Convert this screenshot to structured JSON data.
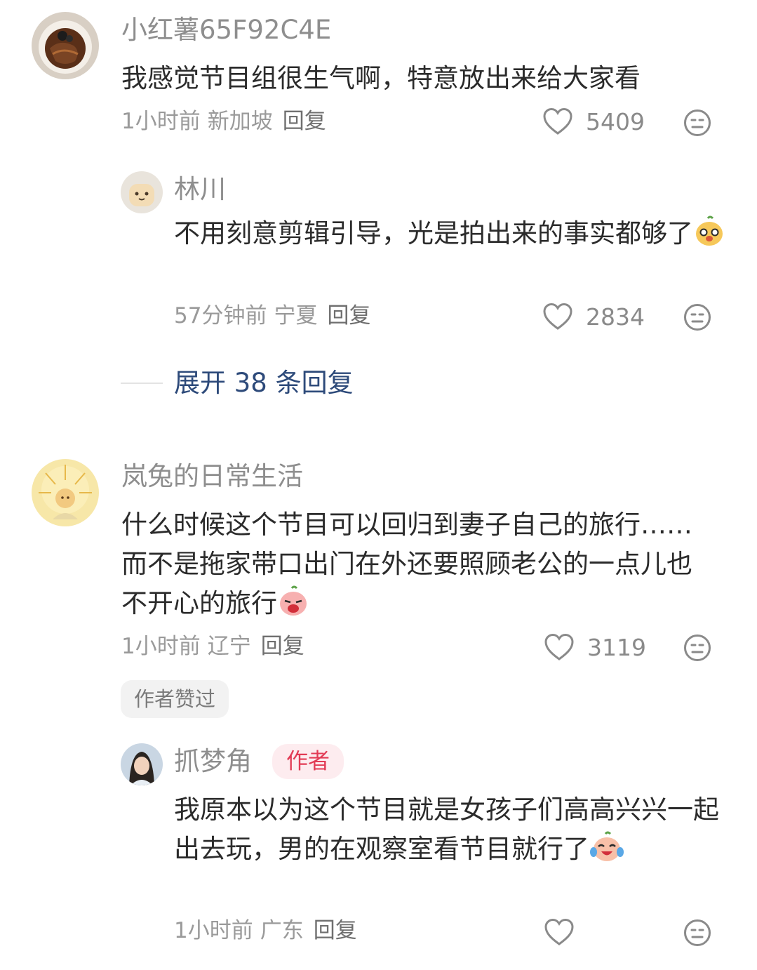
{
  "comments": [
    {
      "username": "小红薯65F92C4E",
      "text": "我感觉节目组很生气啊，特意放出来给大家看",
      "time": "1小时前",
      "region": "新加坡",
      "reply_label": "回复",
      "likes": "5409",
      "reply": {
        "username": "林川",
        "text": "不用刻意剪辑引导，光是拍出来的事实都够了",
        "time": "57分钟前",
        "region": "宁夏",
        "reply_label": "回复",
        "likes": "2834"
      },
      "expand_label": "展开 38 条回复"
    },
    {
      "username": "岚兔的日常生活",
      "text": "什么时候这个节目可以回归到妻子自己的旅行……而不是拖家带口出门在外还要照顾老公的一点儿也不开心的旅行",
      "time": "1小时前",
      "region": "辽宁",
      "reply_label": "回复",
      "likes": "3119",
      "author_liked_label": "作者赞过",
      "reply": {
        "username": "抓梦角",
        "badge": "作者",
        "text": "我原本以为这个节目就是女孩子们高高兴兴一起出去玩，男的在观察室看节目就行了",
        "time": "1小时前",
        "region": "广东",
        "reply_label": "回复"
      }
    }
  ],
  "icons": {
    "like": "heart-outline-icon",
    "dislike": "neutral-face-icon"
  }
}
